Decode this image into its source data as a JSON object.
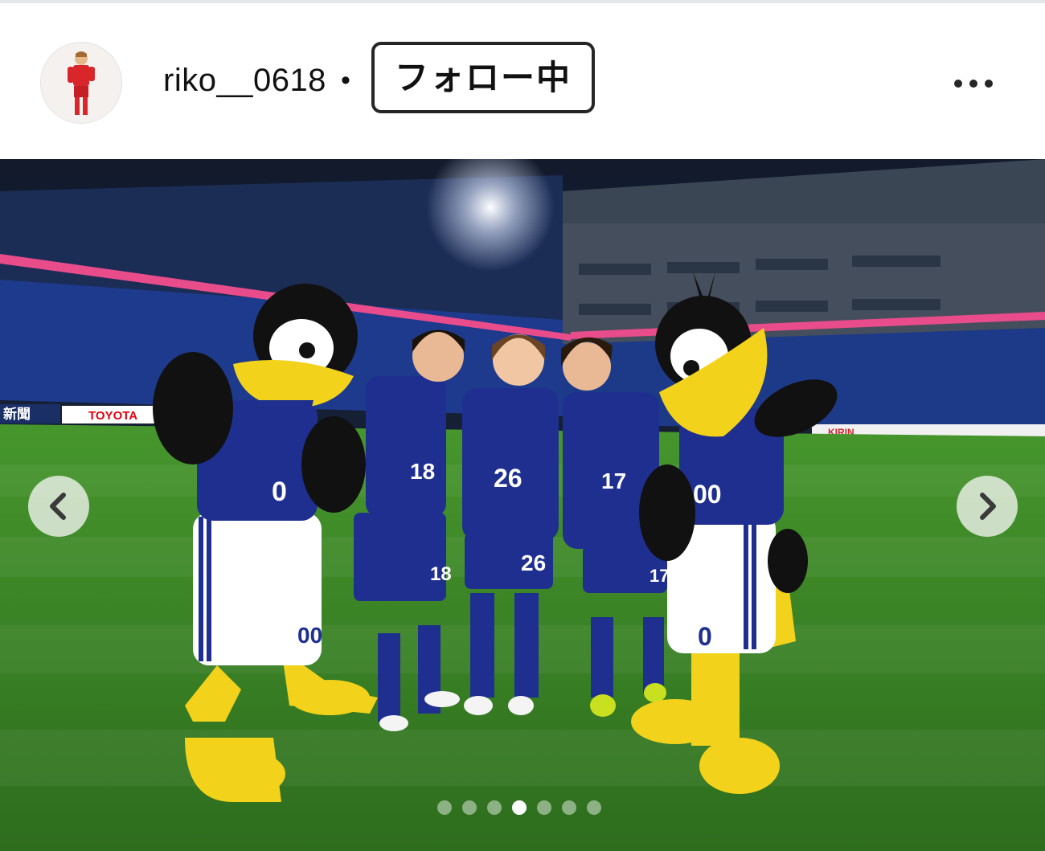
{
  "post_header": {
    "username": "riko__0618",
    "separator": "•",
    "follow_label": "フォロー中",
    "more_icon": "more-horizontal-icon",
    "avatar_icon": "profile-avatar"
  },
  "photo": {
    "ad_boards": {
      "left_newspaper": "新聞",
      "toyota": "TOYOTA",
      "kirin": "KIRIN"
    },
    "mascot_left_number": "0",
    "mascot_left_shorts_number": "00",
    "mascot_right_number": "00",
    "mascot_right_shorts_number": "0",
    "players": [
      {
        "shirt_number": "18",
        "shorts_number": "18"
      },
      {
        "shirt_number": "26",
        "shorts_number": "26"
      },
      {
        "shirt_number": "17",
        "shorts_number": "17"
      }
    ]
  },
  "carousel": {
    "prev_icon": "chevron-left-icon",
    "next_icon": "chevron-right-icon",
    "total_slides": 7,
    "active_index": 3
  },
  "colors": {
    "jersey_blue": "#1f2f8f",
    "pitch_green": "#3f8a2a",
    "mascot_yellow": "#f2d21a",
    "follow_border": "#262626"
  }
}
